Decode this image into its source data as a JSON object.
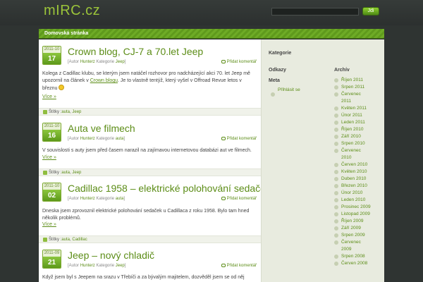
{
  "header": {
    "logo": "mIRC.cz",
    "search_placeholder": "",
    "search_button": "Jdi"
  },
  "nav": {
    "items": [
      "Domovská stránka"
    ]
  },
  "posts": [
    {
      "date_ym": "2011-10",
      "date_day": "17",
      "title": "Crown blog, CJ-7 a 70.let Jeep",
      "meta_prefix": "[Autor",
      "author": "Hunterz",
      "meta_cat": "Kategorie",
      "category": "Jeep",
      "meta_suffix": "]",
      "comment": "Přidat komentář",
      "body_1": "Kolega z Cadillac klubu, se kterým jsem natáčel rozhovor pro nadcházející akci 70. let Jeep mě upozornil na článek v",
      "body_link": "Crown blogu",
      "body_2": ". Je to vlastně tentýž, který vyšel v Offroad Revue letos v březnu",
      "more": "Více »",
      "tags_label": "Štítky :",
      "tags": [
        "auta",
        "Jeep"
      ]
    },
    {
      "date_ym": "2011-10",
      "date_day": "16",
      "title": "Auta ve filmech",
      "meta_prefix": "[Autor",
      "author": "Hunterz",
      "meta_cat": "Kategorie",
      "category": "auta",
      "meta_suffix": "]",
      "comment": "Přidat komentář",
      "body_1": "V souvislosti s auty jsem před časem narazil na zajímavou internetovou databázi aut ve filmech.",
      "more": "Více »",
      "tags_label": "Štítky :",
      "tags": [
        "auta",
        "Jeep"
      ]
    },
    {
      "date_ym": "2011-10",
      "date_day": "02",
      "title": "Cadillac 1958 – elektrické polohování sedaček",
      "meta_prefix": "[Autor",
      "author": "Hunterz",
      "meta_cat": "Kategorie",
      "category": "auta",
      "meta_suffix": "]",
      "comment": "Přidat komentář",
      "body_1": "Dneska jsem zprovoznil elektrické polohování sedaček u Cadillaca z roku 1958. Bylo tam hned několik problémů.",
      "more": "Více »",
      "tags_label": "Štítky :",
      "tags": [
        "auta",
        "Cadillac"
      ]
    },
    {
      "date_ym": "2011-09",
      "date_day": "21",
      "title": "Jeep – nový chladič",
      "meta_prefix": "[Autor",
      "author": "Hunterz",
      "meta_cat": "Kategorie",
      "category": "Jeep",
      "meta_suffix": "]",
      "comment": "Přidat komentář",
      "body_1": "Když jsem byl s Jeepem na srazu v Třebíči a za bývalým majitelem, dozvěděl jsem se od něj"
    }
  ],
  "sidebar": {
    "categories_heading": "Kategorie",
    "links_heading": "Odkazy",
    "meta_heading": "Meta",
    "login": "Přihlásit se",
    "archive_heading": "Archív",
    "archive": [
      "Říjen 2011",
      "Srpen 2011",
      "Červenec 2011",
      "Květen 2011",
      "Únor 2011",
      "Leden 2011",
      "Říjen 2010",
      "Září 2010",
      "Srpen 2010",
      "Červenec 2010",
      "Červen 2010",
      "Květen 2010",
      "Duben 2010",
      "Březen 2010",
      "Únor 2010",
      "Leden 2010",
      "Prosinec 2009",
      "Listopad 2009",
      "Říjen 2009",
      "Září 2009",
      "Srpen 2009",
      "Červenec 2009",
      "Srpen 2008",
      "Červen 2008"
    ]
  },
  "colors": {
    "accent": "#5c8d17",
    "background": "#2f3432",
    "sidebar": "#e8ebdf"
  }
}
